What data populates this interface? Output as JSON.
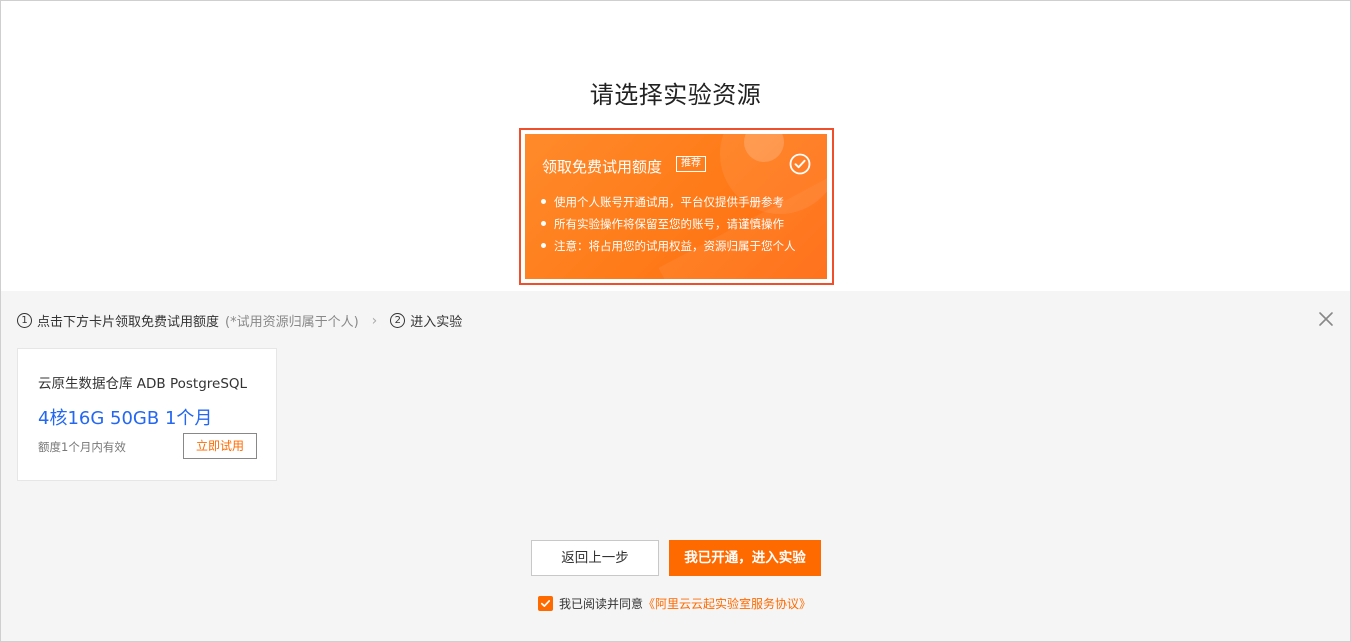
{
  "page_title": "请选择实验资源",
  "free_card": {
    "title": "领取免费试用额度",
    "badge": "推荐",
    "items": [
      "使用个人账号开通试用，平台仅提供手册参考",
      "所有实验操作将保留至您的账号，请谨慎操作",
      "注意：将占用您的试用权益，资源归属于您个人"
    ],
    "selected": true
  },
  "steps": {
    "step1_num": "1",
    "step1_label": "点击下方卡片领取免费试用额度",
    "step1_hint": "(*试用资源归属于个人)",
    "separator": "›",
    "step2_num": "2",
    "step2_label": "进入实验"
  },
  "resource_card": {
    "name": "云原生数据仓库 ADB PostgreSQL",
    "spec": "4核16G 50GB 1个月",
    "validity": "额度1个月内有效",
    "try_button": "立即试用"
  },
  "buttons": {
    "back": "返回上一步",
    "enter": "我已开通，进入实验"
  },
  "agreement": {
    "checked": true,
    "text": "我已阅读并同意",
    "link": "《阿里云云起实验室服务协议》"
  },
  "colors": {
    "accent": "#ff6a00",
    "highlight_border": "#f04f2b",
    "spec_blue": "#2468f2"
  }
}
